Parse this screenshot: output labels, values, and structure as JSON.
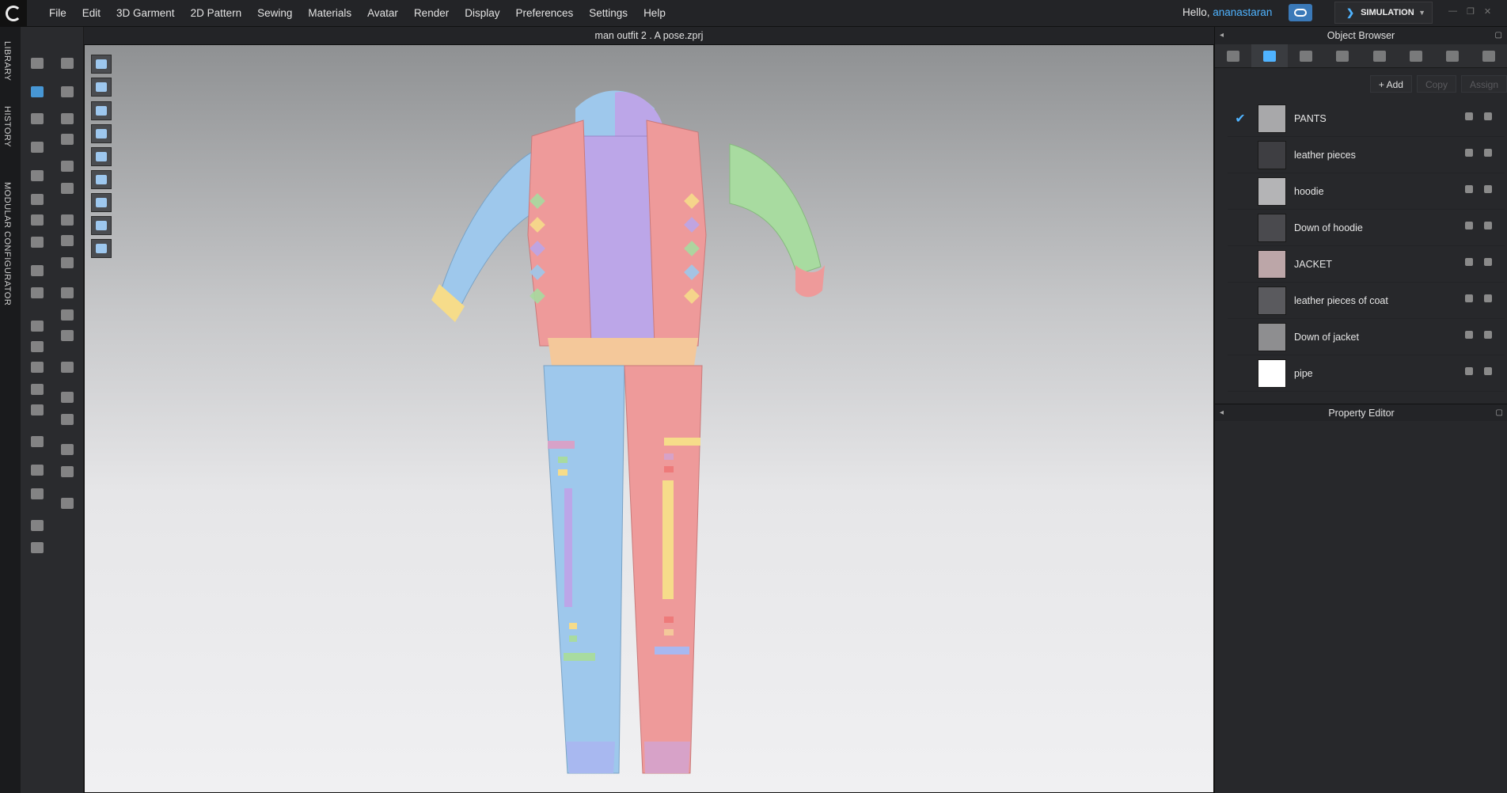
{
  "menu": {
    "items": [
      "File",
      "Edit",
      "3D Garment",
      "2D Pattern",
      "Sewing",
      "Materials",
      "Avatar",
      "Render",
      "Display",
      "Preferences",
      "Settings",
      "Help"
    ]
  },
  "user": {
    "greeting": "Hello, ",
    "name": "ananastaran"
  },
  "mode": {
    "label": "SIMULATION"
  },
  "left_tabs": [
    "LIBRARY",
    "HISTORY",
    "MODULAR CONFIGURATOR"
  ],
  "viewport": {
    "title": "man outfit 2 . A pose.zprj"
  },
  "object_browser": {
    "title": "Object Browser",
    "add_label": "Add",
    "copy_label": "Copy",
    "assign_label": "Assign",
    "materials": [
      {
        "name": "PANTS",
        "color": "#a8a8aa",
        "checked": true
      },
      {
        "name": "leather pieces",
        "color": "#3e3e42",
        "checked": false
      },
      {
        "name": "hoodie",
        "color": "#b4b4b6",
        "checked": false
      },
      {
        "name": "Down of hoodie",
        "color": "#4a4a4e",
        "checked": false
      },
      {
        "name": "JACKET",
        "color": "#bca6a8",
        "checked": false
      },
      {
        "name": "leather pieces of coat",
        "color": "#5a5a5e",
        "checked": false
      },
      {
        "name": "Down of jacket",
        "color": "#8e8e90",
        "checked": false
      },
      {
        "name": "pipe",
        "color": "#ffffff",
        "checked": false
      }
    ]
  },
  "property_editor": {
    "title": "Property Editor"
  },
  "colors": {
    "accent": "#4fb3ff",
    "pastel_blue": "#9ec8ec",
    "pastel_pink": "#ee9a9a",
    "pastel_green": "#a8dba0",
    "pastel_purple": "#bca6e8",
    "pastel_yellow": "#f6dc8a"
  }
}
